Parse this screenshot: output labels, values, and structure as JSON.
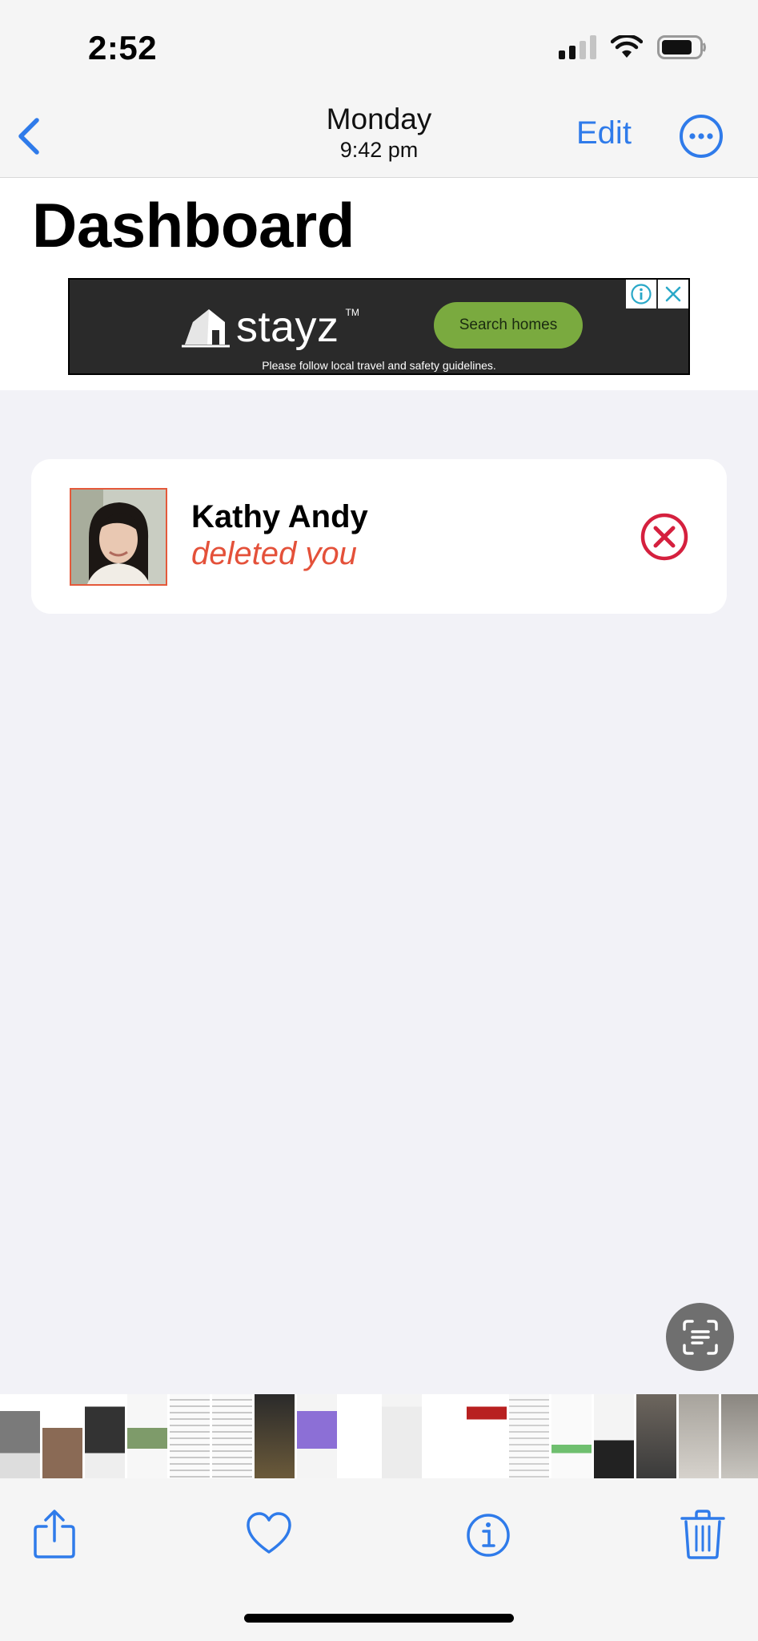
{
  "status_bar": {
    "time": "2:52"
  },
  "nav": {
    "title": "Monday",
    "subtitle": "9:42 pm",
    "edit_label": "Edit",
    "back_icon": "chevron-left-icon",
    "more_icon": "ellipsis-circle-icon"
  },
  "page": {
    "title": "Dashboard"
  },
  "ad": {
    "brand": "stayz",
    "trademark": "TM",
    "cta_label": "Search homes",
    "footer": "Please follow local travel and safety guidelines."
  },
  "notification": {
    "name": "Kathy Andy",
    "status": "deleted you",
    "status_color": "#e4513a",
    "remove_icon": "x-circle-icon"
  },
  "toolbar": {
    "share_icon": "share-icon",
    "favorite_icon": "heart-icon",
    "info_icon": "info-icon",
    "delete_icon": "trash-icon"
  },
  "colors": {
    "accent": "#2f7bea",
    "ad_cta": "#7aaa3f",
    "avatar_border": "#e4593a"
  }
}
